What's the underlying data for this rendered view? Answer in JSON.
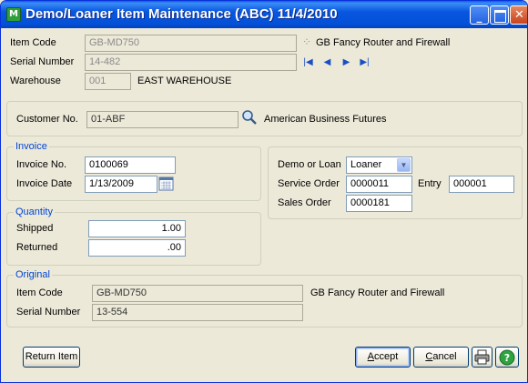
{
  "window": {
    "title": "Demo/Loaner Item Maintenance (ABC) 11/4/2010",
    "app_icon_text": "M"
  },
  "header": {
    "item_code_label": "Item Code",
    "item_code_value": "GB-MD750",
    "item_description": "GB Fancy Router and Firewall",
    "serial_number_label": "Serial Number",
    "serial_number_value": "14-482",
    "warehouse_label": "Warehouse",
    "warehouse_code": "001",
    "warehouse_name": "EAST WAREHOUSE"
  },
  "customer": {
    "label": "Customer No.",
    "value": "01-ABF",
    "name": "American Business Futures"
  },
  "invoice": {
    "group_label": "Invoice",
    "invoice_no_label": "Invoice No.",
    "invoice_no_value": "0100069",
    "invoice_date_label": "Invoice Date",
    "invoice_date_value": "1/13/2009"
  },
  "quantity": {
    "group_label": "Quantity",
    "shipped_label": "Shipped",
    "shipped_value": "1.00",
    "returned_label": "Returned",
    "returned_value": ".00"
  },
  "demo": {
    "demo_or_loan_label": "Demo or Loan",
    "demo_or_loan_value": "Loaner",
    "service_order_label": "Service Order",
    "service_order_value": "0000011",
    "entry_label": "Entry",
    "entry_value": "000001",
    "sales_order_label": "Sales Order",
    "sales_order_value": "0000181"
  },
  "original": {
    "group_label": "Original",
    "item_code_label": "Item Code",
    "item_code_value": "GB-MD750",
    "item_description": "GB Fancy Router and Firewall",
    "serial_number_label": "Serial Number",
    "serial_number_value": "13-554"
  },
  "buttons": {
    "return_item": "Return Item",
    "accept": "Accept",
    "cancel": "Cancel"
  },
  "icons": {
    "nav_first": "first-record-icon",
    "nav_prev": "previous-record-icon",
    "nav_next": "next-record-icon",
    "nav_last": "last-record-icon",
    "lookup": "magnifier-icon",
    "calendar": "calendar-icon",
    "print": "printer-icon",
    "help": "help-icon"
  }
}
